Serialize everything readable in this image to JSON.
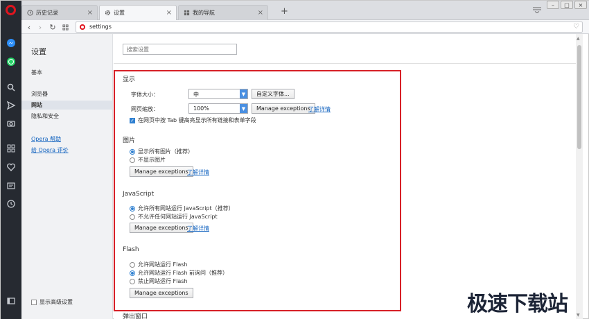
{
  "tabs": [
    {
      "label": "历史记录",
      "icon": "clock-icon",
      "active": false
    },
    {
      "label": "设置",
      "icon": "gear-icon",
      "active": true
    },
    {
      "label": "我的导航",
      "icon": "grid-icon",
      "active": false
    }
  ],
  "address": {
    "url": "settings"
  },
  "sidebar": {
    "title": "设置",
    "items": [
      {
        "label": "基本"
      },
      {
        "label": "浏览器"
      },
      {
        "label": "网站",
        "active": true
      },
      {
        "label": "隐私和安全"
      }
    ],
    "links": [
      {
        "label": "Opera 帮助"
      },
      {
        "label": "给 Opera 评价"
      }
    ],
    "advanced_label": "显示高级设置"
  },
  "search": {
    "placeholder": "搜索设置"
  },
  "display": {
    "title": "显示",
    "font_size_label": "字体大小：",
    "font_size_value": "中",
    "custom_font_button": "自定义字体...",
    "zoom_label": "网页缩放：",
    "zoom_value": "100%",
    "manage_exceptions": "Manage exceptions",
    "learn_more": "了解详情",
    "tab_highlight_label": "在网页中按 Tab 键高亮显示所有链接和表单字段"
  },
  "images": {
    "title": "图片",
    "options": [
      "显示所有图片（推荐）",
      "不显示图片"
    ],
    "manage_exceptions": "Manage exceptions",
    "learn_more": "了解详情"
  },
  "javascript": {
    "title": "JavaScript",
    "options": [
      "允许所有网站运行 JavaScript（推荐）",
      "不允许任何网站运行 JavaScript"
    ],
    "manage_exceptions": "Manage exceptions",
    "learn_more": "了解详情"
  },
  "flash": {
    "title": "Flash",
    "options": [
      "允许网站运行 Flash",
      "允许网站运行 Flash 前询问（推荐）",
      "禁止网站运行 Flash"
    ],
    "manage_exceptions": "Manage exceptions"
  },
  "popups": {
    "title": "弹出窗口"
  },
  "watermark": "极速下载站",
  "colors": {
    "accent": "#2f80d1",
    "highlight": "#d72027",
    "opera_red": "#e0151f",
    "sidebar_bg": "#262a31"
  }
}
